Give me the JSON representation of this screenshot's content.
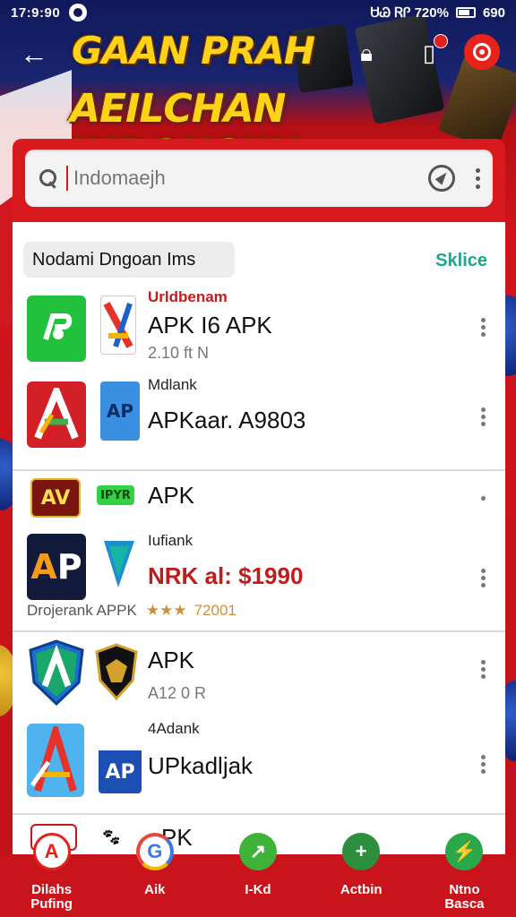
{
  "status_bar": {
    "time": "17:9:90",
    "right_text": "ᏌᏊ ᏒᎵ 720%",
    "battery_text": "690"
  },
  "header": {
    "title_line1": "GAAN PRAH",
    "title_line2": "AEILCHAN INDONSIIN"
  },
  "search": {
    "placeholder": "Indomaejh",
    "value": "Indomaejh"
  },
  "section": {
    "chip_label": "Nodami Dngoan  Ims",
    "see_all": "Sklice"
  },
  "apps": [
    {
      "top": "Urldbenam",
      "top_red": true,
      "main": "APK I6 APK",
      "sub": "2.10 ft N"
    },
    {
      "top": "Mdlank",
      "main": "APKaar. A9803",
      "sub": ""
    },
    {
      "top": "",
      "main": "APK",
      "sub": ""
    },
    {
      "top": "Iufiank",
      "main": "NRK al: $1990",
      "main_red": true,
      "sub": ""
    },
    {
      "top": "",
      "main": "APK",
      "sub": "A12 0 R"
    },
    {
      "top": "4Adank",
      "main": "UPkadljak",
      "sub": ""
    }
  ],
  "rating_row": {
    "left": "Drojerank  APPK",
    "stars": "★★★",
    "score": "72001"
  },
  "icons": {
    "row1_big": "AP",
    "row1_small_label": "",
    "row2_small": "AP",
    "row3_small_badge": "IPYR",
    "row4_big": "AP",
    "row6_small": "AP"
  },
  "peek_row": {
    "main": "PK"
  },
  "bottom_nav": [
    {
      "label": "Dilahs\nPufing",
      "color": "#e3231c",
      "glyph": "A"
    },
    {
      "label": "Aik",
      "color": "#e9453a",
      "glyph": "G"
    },
    {
      "label": "I-Kd",
      "color": "#3fb23a",
      "glyph": "↗"
    },
    {
      "label": "Actbin",
      "color": "#2d8e3e",
      "glyph": "+"
    },
    {
      "label": "Ntno\nBasca",
      "color": "#2aa84a",
      "glyph": "⚡"
    }
  ],
  "colors": {
    "accent_red": "#d81a1f",
    "link_teal": "#1ba58f",
    "title_yellow": "#ffd21a",
    "navy": "#10195a"
  }
}
